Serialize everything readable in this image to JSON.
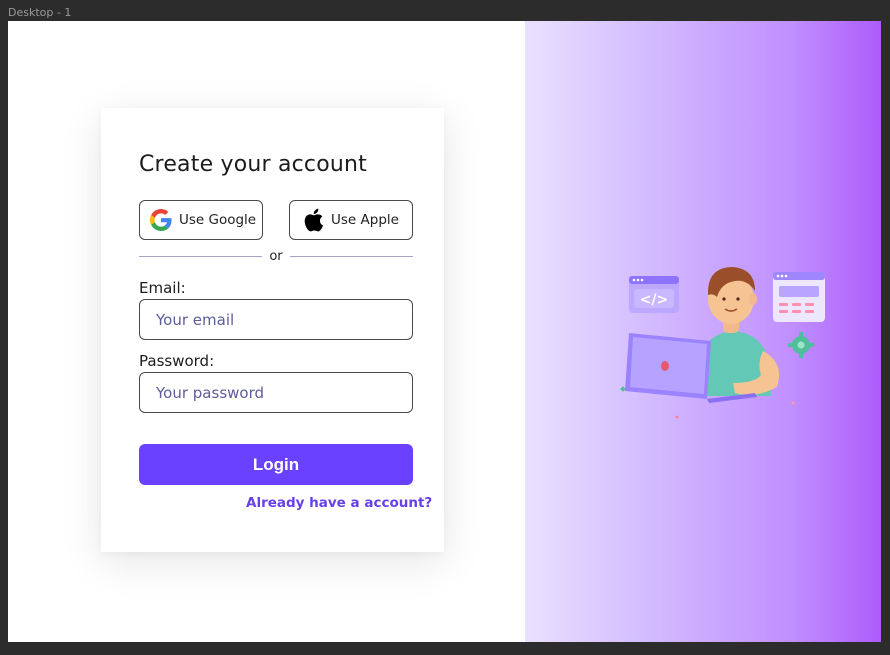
{
  "canvas": {
    "frame_label": "Desktop - 1"
  },
  "form": {
    "title": "Create your account",
    "google_label": "Use Google",
    "apple_label": "Use Apple",
    "divider_text": "or",
    "email_label": "Email:",
    "email_placeholder": "Your email",
    "email_value": "",
    "password_label": "Password:",
    "password_placeholder": "Your password",
    "password_value": "",
    "login_label": "Login",
    "account_link": "Already have a account?"
  },
  "colors": {
    "accent": "#6941ff",
    "link": "#6741e8",
    "gradient_start": "#e9e1ff",
    "gradient_end": "#ad5cfb"
  },
  "icons": [
    "google-icon",
    "apple-icon"
  ]
}
